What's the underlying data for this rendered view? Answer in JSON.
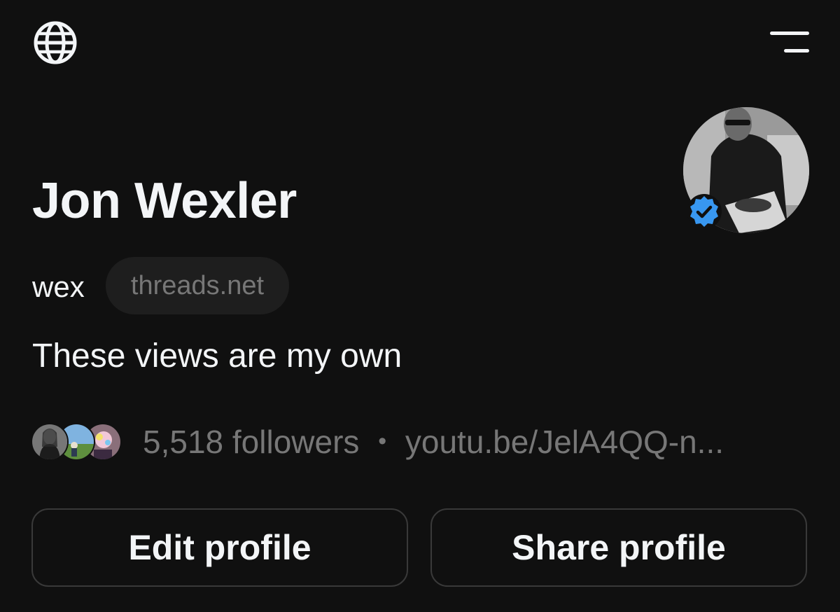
{
  "header": {
    "left_icon": "globe-icon",
    "right_icon": "menu-icon"
  },
  "profile": {
    "display_name": "Jon Wexler",
    "username": "wex",
    "domain_badge": "threads.net",
    "bio": "These views are my own",
    "verified": true,
    "verified_color": "#3897f0"
  },
  "stats": {
    "followers_text": "5,518 followers",
    "separator": "•",
    "link_text": "youtu.be/JelA4QQ-n..."
  },
  "actions": {
    "edit_label": "Edit profile",
    "share_label": "Share profile"
  },
  "colors": {
    "background": "#101010",
    "text_primary": "#f3f5f7",
    "text_secondary": "#777777",
    "button_border": "#393939",
    "pill_background": "#1e1e1e"
  }
}
